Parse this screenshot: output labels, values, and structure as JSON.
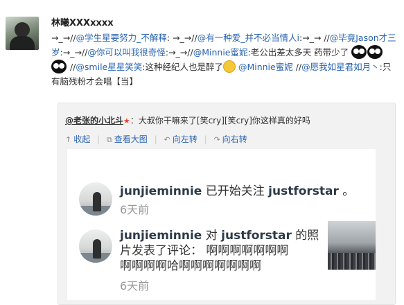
{
  "post": {
    "author": "林曦XXXxxxx",
    "parts": {
      "p1": "→_→//",
      "m1": "@学生星要努力_不解释",
      "p2": ": →_→//",
      "m2": "@有一种爱_并不必当情人i",
      "p3": ":→_→ //",
      "m3": "@毕竟Jason才三岁",
      "p4": ":→_→//",
      "m4": "@你可以叫我很奇怪",
      "p5": ":→_→//",
      "m5": "@Minnie蜜妮",
      "p6": ":老公出差太多天 药带少了",
      "p7": " //",
      "m6": "@smile星星笑笑",
      "p8": ":这种经纪人也是醉了",
      "m7": "@Minnie蜜妮",
      "p9": " //",
      "m8": "@愿我如星君如月丶",
      "p10": ":只有脑残粉才会唱【当】"
    }
  },
  "repost": {
    "user": "@老张的小北斗",
    "colon": "：",
    "text": "大叔你干嘛来了[笑cry][笑cry]你这样真的好吗",
    "toolbar": {
      "collapse": "收起",
      "view_large": "查看大图",
      "rotate_left": "向左转",
      "rotate_right": "向右转"
    }
  },
  "photo": {
    "row1": {
      "user": "junjieminnie",
      "action": " 已开始关注 ",
      "target": "justforstar",
      "end": " 。",
      "time": "6天前"
    },
    "row2": {
      "user": "junjieminnie",
      "action": " 对 ",
      "target": "justforstar",
      "end": " 的照",
      "line2": "片发表了评论：  啊啊啊啊啊啊啊",
      "line3": "啊啊啊啊哈啊啊啊啊啊啊啊",
      "time": "6天前"
    }
  }
}
